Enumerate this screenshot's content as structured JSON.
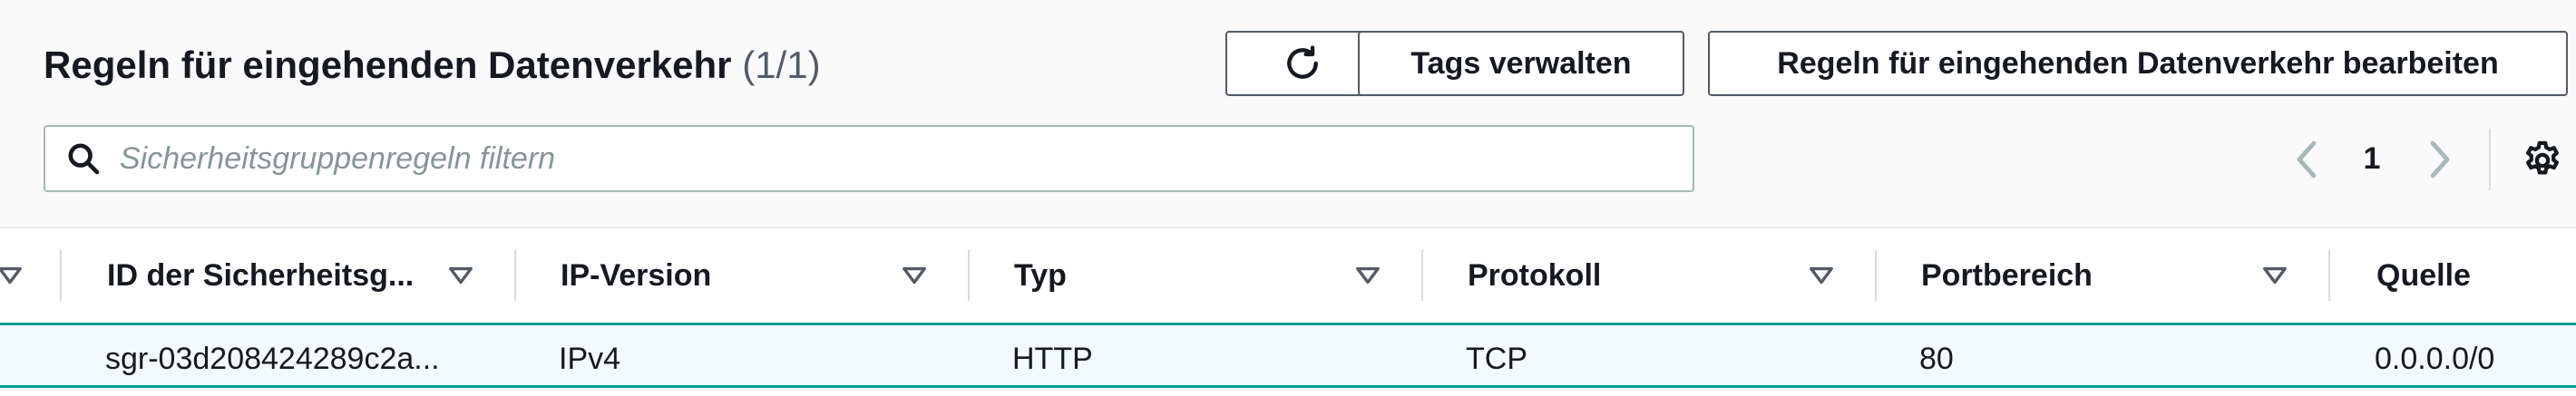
{
  "header": {
    "title": "Regeln für eingehenden Datenverkehr",
    "count": "(1/1)"
  },
  "toolbar": {
    "refresh_icon": "refresh-icon",
    "tags_label": "Tags verwalten",
    "edit_label": "Regeln für eingehenden Datenverkehr bearbeiten"
  },
  "search": {
    "icon": "search-icon",
    "placeholder": "Sicherheitsgruppenregeln filtern",
    "value": ""
  },
  "pagination": {
    "current_page": "1",
    "prev_icon": "chevron-left-icon",
    "next_icon": "chevron-right-icon",
    "settings_icon": "gear-icon"
  },
  "table": {
    "columns": [
      "ID der Sicherheitsg...",
      "IP-Version",
      "Typ",
      "Protokoll",
      "Portbereich",
      "Quelle"
    ],
    "rows": [
      [
        "sgr-03d208424289c2a...",
        "IPv4",
        "HTTP",
        "TCP",
        "80",
        "0.0.0.0/0"
      ]
    ]
  },
  "colors": {
    "selected_row_border": "#0a9e9a",
    "selected_row_background": "#f1faff",
    "button_border": "#545b64"
  }
}
